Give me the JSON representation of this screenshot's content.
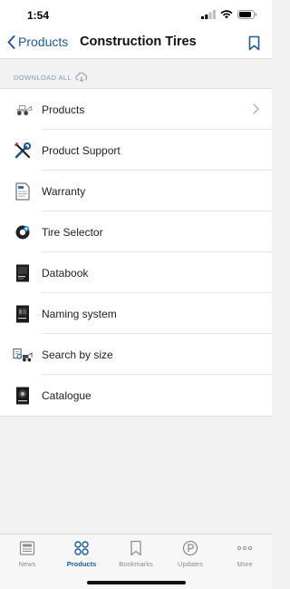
{
  "status": {
    "time": "1:54"
  },
  "nav": {
    "back_label": "Products",
    "title": "Construction Tires"
  },
  "download_all": "DOWNLOAD ALL",
  "menu": [
    {
      "label": "Products",
      "icon": "loader-vehicle-icon",
      "has_chevron": true
    },
    {
      "label": "Product Support",
      "icon": "tools-icon",
      "has_chevron": false
    },
    {
      "label": "Warranty",
      "icon": "document-icon",
      "has_chevron": false
    },
    {
      "label": "Tire Selector",
      "icon": "tire-selector-icon",
      "has_chevron": false
    },
    {
      "label": "Databook",
      "icon": "databook-icon",
      "has_chevron": false
    },
    {
      "label": "Naming system",
      "icon": "naming-book-icon",
      "has_chevron": false
    },
    {
      "label": "Search by size",
      "icon": "search-size-icon",
      "has_chevron": false
    },
    {
      "label": "Catalogue",
      "icon": "catalogue-icon",
      "has_chevron": false
    }
  ],
  "tabs": [
    {
      "label": "News",
      "icon": "news-icon",
      "active": false
    },
    {
      "label": "Products",
      "icon": "grid-icon",
      "active": true
    },
    {
      "label": "Bookmarks",
      "icon": "bookmark-icon",
      "active": false
    },
    {
      "label": "Updates",
      "icon": "updates-icon",
      "active": false
    },
    {
      "label": "More",
      "icon": "more-icon",
      "active": false
    }
  ],
  "colors": {
    "accent": "#1e5b9c",
    "background": "#f2f2f2",
    "inactive_tab": "#8e8e8e"
  }
}
